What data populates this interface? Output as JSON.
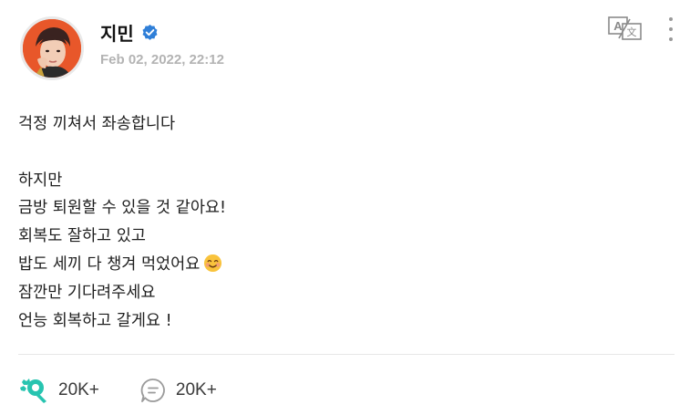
{
  "post": {
    "author_name": "지민",
    "timestamp": "Feb 02, 2022, 22:12",
    "lines": [
      "걱정 끼쳐서 좌송합니다",
      "",
      "하지만",
      "금방 퇴원할 수 있을 것 같아요!",
      "회복도 잘하고 있고",
      "밥도 세끼 다 챙겨 먹었어요",
      "잠깐만 기다려주세요",
      "언능 회복하고 갈게요 !"
    ]
  },
  "actions": {
    "likes_count": "20K+",
    "comments_count": "20K+"
  },
  "icons": {
    "verified": "verified-badge-icon",
    "translate": "translate-icon",
    "more": "more-vertical-icon",
    "like": "light-stick-icon",
    "comment": "comment-icon",
    "emoji": "smiling-face-emoji"
  },
  "colors": {
    "verified_blue": "#2f7fd8",
    "like_teal": "#27c4b0",
    "avatar_bg": "#e8572a"
  }
}
